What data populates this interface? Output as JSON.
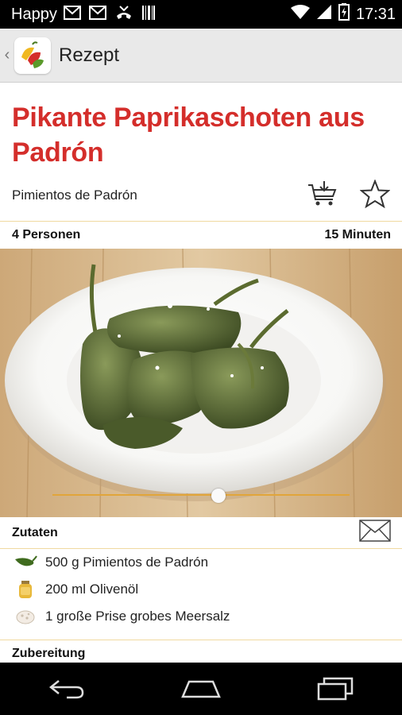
{
  "status_bar": {
    "carrier": "Happy",
    "time": "17:31",
    "icons": [
      "gmail-icon",
      "gmail-icon",
      "missed-call-icon",
      "barcode-icon",
      "wifi-icon",
      "signal-icon",
      "battery-charging-icon"
    ]
  },
  "action_bar": {
    "title": "Rezept",
    "logo_icon": "peppers-app-logo"
  },
  "recipe": {
    "title": "Pikante Paprikaschoten aus Padrón",
    "subtitle": "Pimientos de Padrón",
    "servings": "4 Personen",
    "time": "15 Minuten",
    "image_alt_icon": "pimientos-plate-photo"
  },
  "gallery": {
    "position": 0.56
  },
  "ingredients_section": {
    "title": "Zutaten",
    "items": [
      {
        "icon": "green-pepper-icon",
        "text": "500 g Pimientos de Padrón"
      },
      {
        "icon": "oil-jar-icon",
        "text": "200 ml Olivenöl"
      },
      {
        "icon": "salt-icon",
        "text": "1 große Prise grobes Meersalz"
      }
    ]
  },
  "preparation_section": {
    "title": "Zubereitung"
  },
  "colors": {
    "title_red": "#d42e2b",
    "accent_gold": "#e1a53a",
    "actionbar_bg": "#e9e9e9"
  }
}
